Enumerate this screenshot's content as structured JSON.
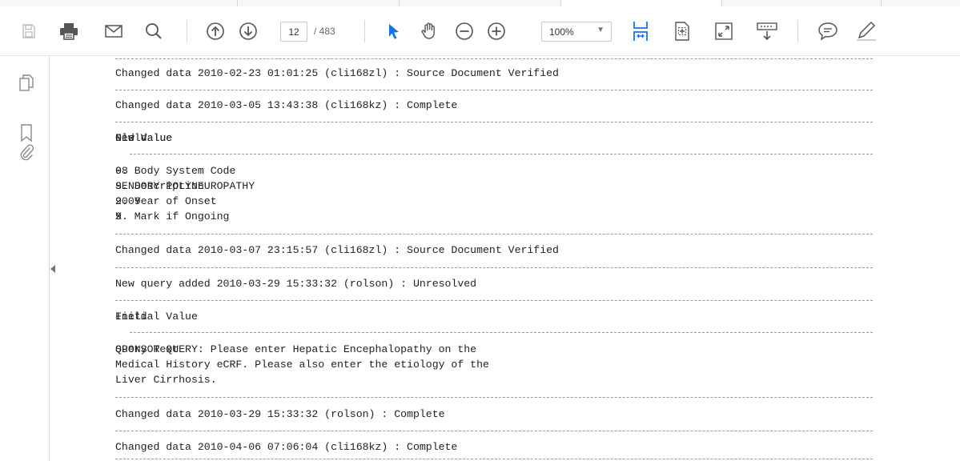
{
  "toolbar": {
    "page_current": "12",
    "page_total": "/ 483",
    "zoom": "100%",
    "icons": [
      "save-icon",
      "print-icon",
      "email-icon",
      "search-icon",
      "page-up-icon",
      "page-down-icon",
      "select-arrow-icon",
      "hand-icon",
      "zoom-out-icon",
      "zoom-in-icon",
      "fit-page-icon",
      "rotate-page-icon",
      "fullscreen-icon",
      "read-mode-icon",
      "comment-icon",
      "highlight-icon"
    ]
  },
  "sidebar": {
    "icons": [
      "pages-icon",
      "bookmark-icon",
      "attachment-icon"
    ]
  },
  "document": {
    "entries": [
      {
        "header": "Changed data 2010-02-23 01:01:25 (cli168zl) : Source Document Verified"
      },
      {
        "header": "Changed data 2010-03-05 13:43:38 (cli168kz) : Complete",
        "table": {
          "columns": [
            "Field",
            "Old Value",
            "New Value"
          ],
          "rows": [
            [
              "9. Body System Code",
              "",
              "08"
            ],
            [
              "9. Description",
              "",
              "SENSORY POLYNEUROPATHY"
            ],
            [
              "9. Year of Onset",
              "",
              "2009"
            ],
            [
              "9. Mark if Ongoing",
              "",
              "X"
            ]
          ]
        }
      },
      {
        "header": "Changed data 2010-03-07 23:15:57 (cli168zl) : Source Document Verified"
      },
      {
        "header": "New query added 2010-03-29 15:33:32 (rolson) : Unresolved",
        "table": {
          "columns": [
            "Field",
            "Initial Value"
          ],
          "rows": [
            [
              "Query Text",
              "SPONSOR QUERY: Please enter Hepatic Encephalopathy on the",
              "Medical History eCRF. Please also enter the etiology of the",
              "Liver Cirrhosis."
            ]
          ]
        }
      },
      {
        "header": "Changed data 2010-03-29 15:33:32 (rolson) : Complete"
      },
      {
        "header": "Changed data 2010-04-06 07:06:04 (cli168kz) : Complete"
      }
    ]
  }
}
